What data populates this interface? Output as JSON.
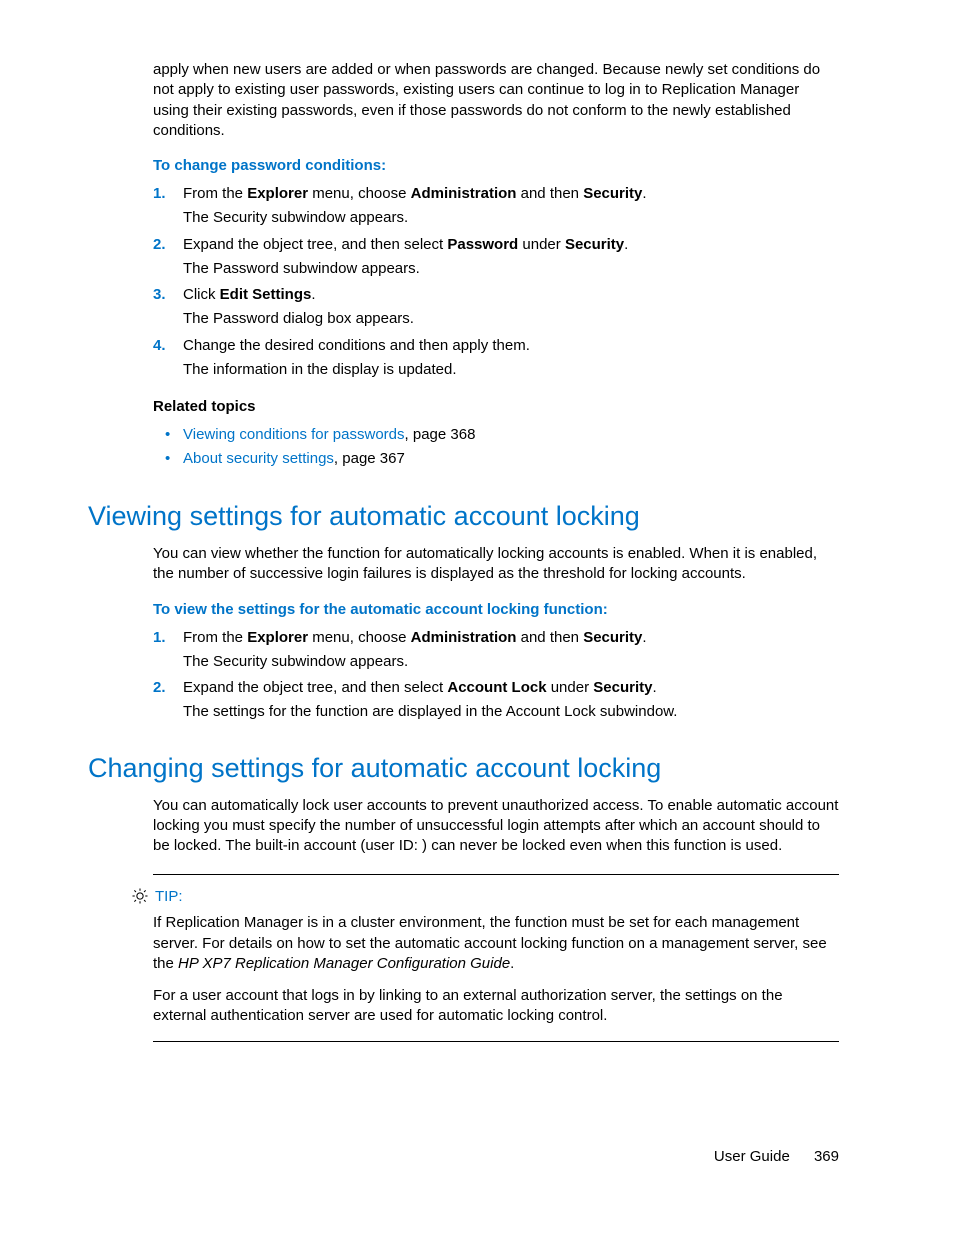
{
  "intro_paragraph": "apply when new users are added or when passwords are changed. Because newly set conditions do not apply to existing user passwords, existing users can continue to log in to Replication Manager using their existing passwords, even if those passwords do not conform to the newly established conditions.",
  "subhead1": "To change password conditions:",
  "steps1": [
    {
      "num": "1.",
      "parts": [
        "From the ",
        "Explorer",
        " menu, choose ",
        "Administration",
        " and then ",
        "Security",
        "."
      ],
      "followup": "The Security subwindow appears."
    },
    {
      "num": "2.",
      "parts": [
        "Expand the object tree, and then select ",
        "Password",
        " under ",
        "Security",
        "."
      ],
      "followup": "The Password subwindow appears."
    },
    {
      "num": "3.",
      "parts": [
        "Click ",
        "Edit Settings",
        "."
      ],
      "followup": "The Password dialog box appears."
    },
    {
      "num": "4.",
      "parts": [
        "Change the desired conditions and then apply them."
      ],
      "followup": "The information in the display is updated."
    }
  ],
  "related_hdr": "Related topics",
  "related": [
    {
      "link": "Viewing conditions for passwords",
      "suffix": ", page 368"
    },
    {
      "link": "About security settings",
      "suffix": ", page 367"
    }
  ],
  "section2_title": "Viewing settings for automatic account locking",
  "section2_intro": "You can view whether the function for automatically locking accounts is enabled. When it is enabled, the number of successive login failures is displayed as the threshold for locking accounts.",
  "subhead2": "To view the settings for the automatic account locking function:",
  "steps2": [
    {
      "num": "1.",
      "parts": [
        "From the ",
        "Explorer",
        " menu, choose ",
        "Administration",
        " and then ",
        "Security",
        "."
      ],
      "followup": "The Security subwindow appears."
    },
    {
      "num": "2.",
      "parts": [
        "Expand the object tree, and then select ",
        "Account Lock",
        " under ",
        "Security",
        "."
      ],
      "followup": "The settings for the function are displayed in the Account Lock subwindow."
    }
  ],
  "section3_title": "Changing settings for automatic account locking",
  "section3_intro": "You can automatically lock user accounts to prevent unauthorized access. To enable automatic account locking you must specify the number of unsuccessful login attempts after which an account should to be locked. The built-in account (user ID:           ) can never be locked even when this function is used.",
  "tip_label": "TIP:",
  "tip_p1_a": "If Replication Manager is in a cluster environment, the function must be set for each management server. For details on how to set the automatic account locking function on a management server, see the ",
  "tip_p1_i": "HP XP7 Replication Manager Configuration Guide",
  "tip_p1_b": ".",
  "tip_p2": "For a user account that logs in by linking to an external authorization server, the settings on the external authentication server are used for automatic locking control.",
  "footer_label": "User Guide",
  "footer_page": "369"
}
